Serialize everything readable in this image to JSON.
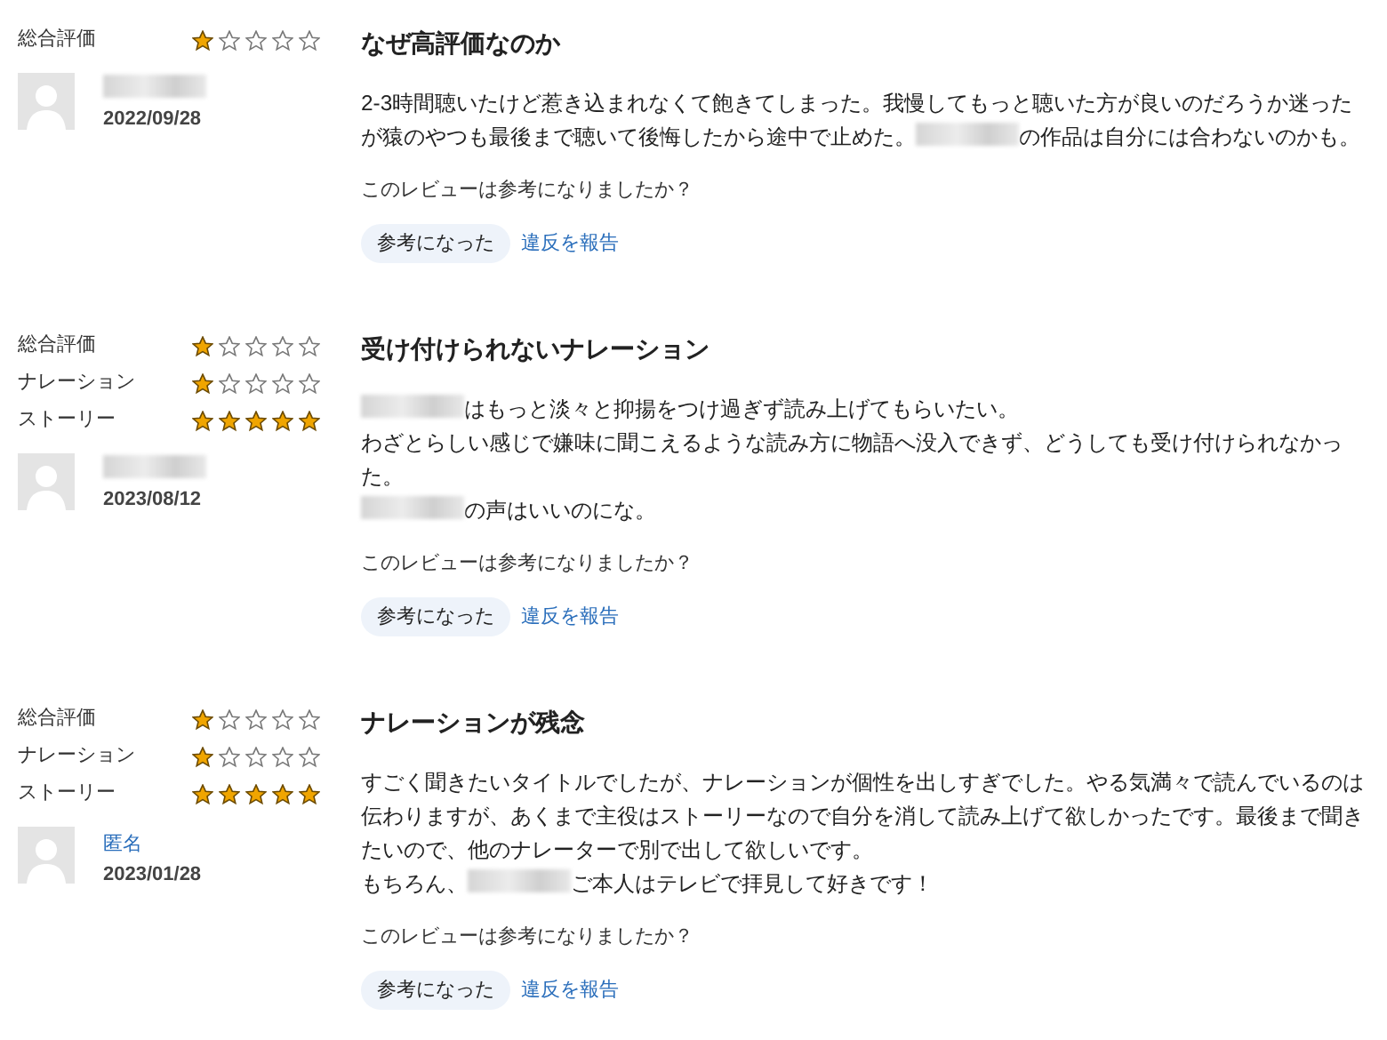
{
  "reviews": [
    {
      "ratings": [
        {
          "label": "総合評価",
          "stars": 1
        }
      ],
      "reviewer": {
        "kind": "redacted"
      },
      "date": "2022/09/28",
      "title": "なぜ高評価なのか",
      "body": [
        [
          {
            "kind": "text",
            "text": "2-3時間聴いたけど惹き込まれなくて飽きてしまった。我慢してもっと聴いた方が良いのだろうか迷った"
          }
        ],
        [
          {
            "kind": "text",
            "text": "が猿のやつも最後まで聴いて後悔したから途中で止めた。"
          },
          {
            "kind": "redacted"
          },
          {
            "kind": "text",
            "text": "の作品は自分には合わないのかも。"
          }
        ]
      ],
      "question": "このレビューは参考になりましたか？",
      "helpful_button": "参考になった",
      "report_link": "違反を報告"
    },
    {
      "ratings": [
        {
          "label": "総合評価",
          "stars": 1
        },
        {
          "label": "ナレーション",
          "stars": 1
        },
        {
          "label": "ストーリー",
          "stars": 5
        }
      ],
      "reviewer": {
        "kind": "redacted"
      },
      "date": "2023/08/12",
      "title": "受け付けられないナレーション",
      "body": [
        [
          {
            "kind": "redacted"
          },
          {
            "kind": "text",
            "text": "はもっと淡々と抑揚をつけ過ぎず読み上げてもらいたい。"
          }
        ],
        [
          {
            "kind": "text",
            "text": "わざとらしい感じで嫌味に聞こえるような読み方に物語へ没入できず、どうしても受け付けられなかった。"
          }
        ],
        [
          {
            "kind": "redacted"
          },
          {
            "kind": "text",
            "text": "の声はいいのにな。"
          }
        ]
      ],
      "question": "このレビューは参考になりましたか？",
      "helpful_button": "参考になった",
      "report_link": "違反を報告"
    },
    {
      "ratings": [
        {
          "label": "総合評価",
          "stars": 1
        },
        {
          "label": "ナレーション",
          "stars": 1
        },
        {
          "label": "ストーリー",
          "stars": 5
        }
      ],
      "reviewer": {
        "kind": "name",
        "name": "匿名"
      },
      "date": "2023/01/28",
      "title": "ナレーションが残念",
      "body": [
        [
          {
            "kind": "text",
            "text": "すごく聞きたいタイトルでしたが、ナレーションが個性を出しすぎでした。やる気満々で読んでいるのは伝わりますが、あくまで主役はストーリーなので自分を消して読み上げて欲しかったです。最後まで聞きたいので、他のナレーターで別で出して欲しいです。"
          }
        ],
        [
          {
            "kind": "text",
            "text": "もちろん、"
          },
          {
            "kind": "redacted"
          },
          {
            "kind": "text",
            "text": "ご本人はテレビで拝見して好きです！"
          }
        ]
      ],
      "question": "このレビューは参考になりましたか？",
      "helpful_button": "参考になった",
      "report_link": "違反を報告"
    }
  ]
}
